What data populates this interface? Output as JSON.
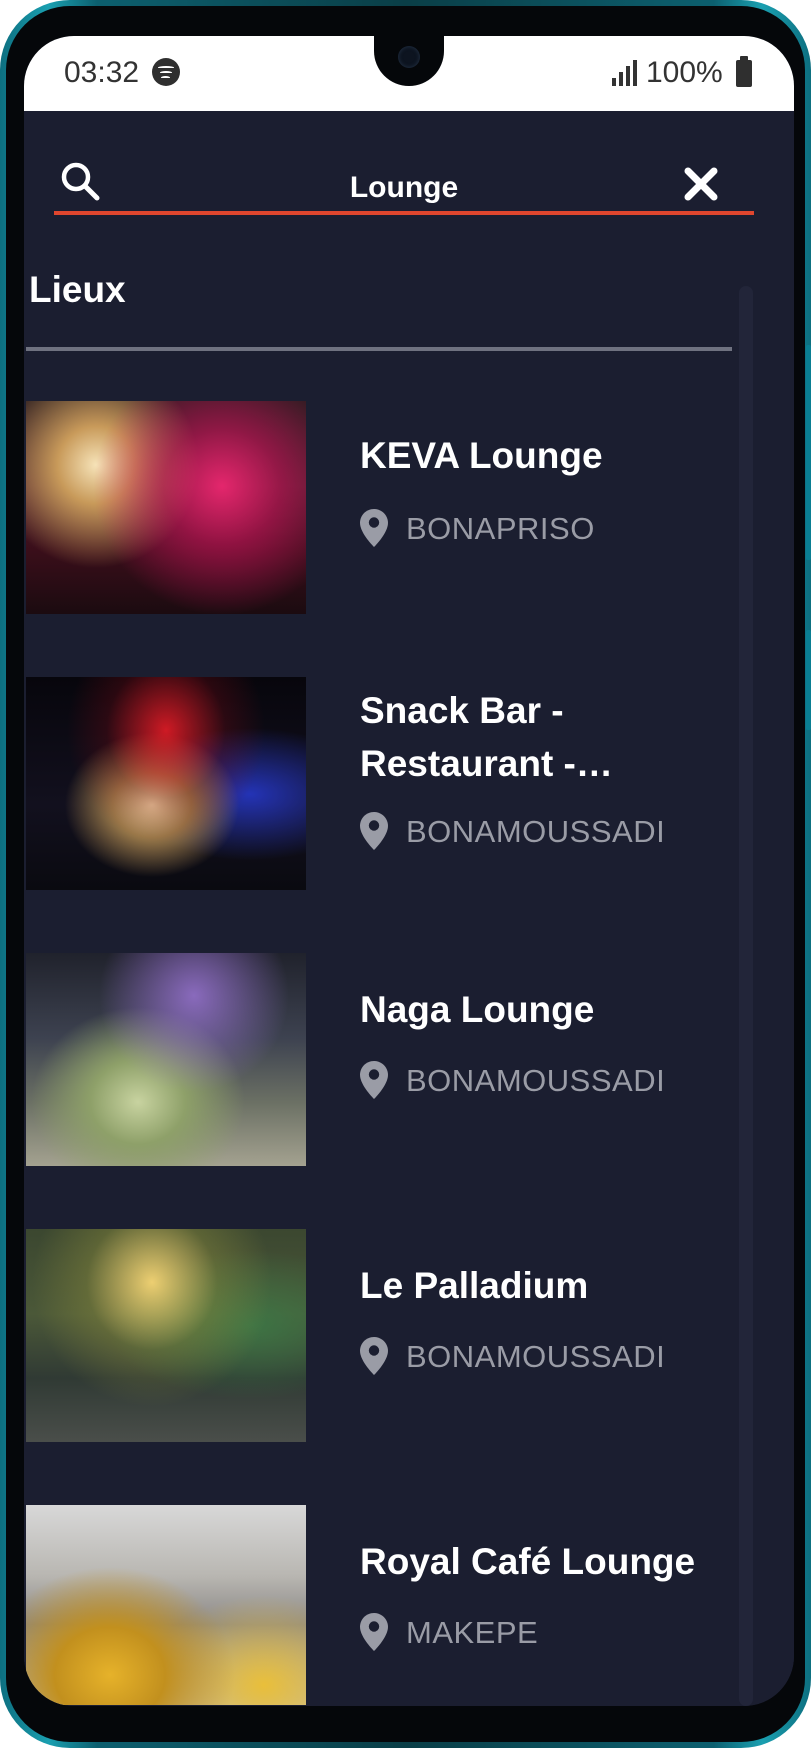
{
  "status_bar": {
    "time": "03:32",
    "battery": "100%",
    "icons": [
      "spotify-icon",
      "signal-icon",
      "battery-icon"
    ]
  },
  "search": {
    "query": "Lounge",
    "icon": "search-icon",
    "clear_icon": "close-icon",
    "underline_color": "#e0462e"
  },
  "section": {
    "title": "Lieux"
  },
  "venues": [
    {
      "name": "KEVA Lounge",
      "location": "BONAPRISO"
    },
    {
      "name": "Snack Bar - Restaurant -…",
      "location": "BONAMOUSSADI"
    },
    {
      "name": "Naga Lounge",
      "location": "BONAMOUSSADI"
    },
    {
      "name": "Le Palladium",
      "location": "BONAMOUSSADI"
    },
    {
      "name": "Royal Café Lounge",
      "location": "MAKEPE"
    }
  ],
  "theme": {
    "background": "#1b1e30",
    "text": "#ffffff",
    "muted_text": "#9a9ca6",
    "accent": "#e0462e"
  }
}
